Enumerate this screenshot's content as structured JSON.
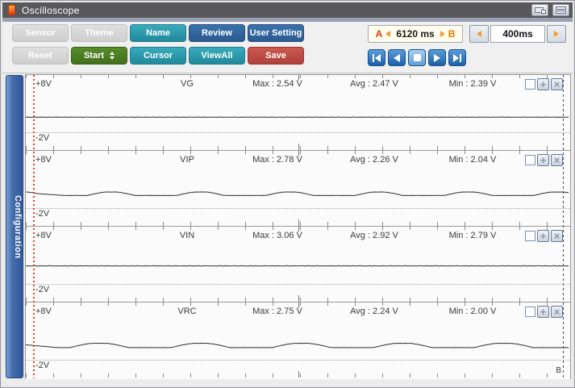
{
  "window": {
    "title": "Oscilloscope"
  },
  "toolbar": {
    "row1": [
      {
        "label": "Sensor"
      },
      {
        "label": "Theme"
      },
      {
        "label": "Name"
      },
      {
        "label": "Review"
      },
      {
        "label": "User Setting"
      }
    ],
    "row2": [
      {
        "label": "Reset"
      },
      {
        "label": "Start"
      },
      {
        "label": "Cursor"
      },
      {
        "label": "ViewAll"
      },
      {
        "label": "Save"
      }
    ],
    "ab_range": {
      "a_label": "A",
      "value": "6120 ms",
      "b_label": "B"
    },
    "timebase": {
      "value": "400ms"
    }
  },
  "sidebar": {
    "label": "Configuration"
  },
  "cursors": {
    "b_label": "B"
  },
  "channel_controls": {
    "plus_glyph": "+",
    "close_glyph": "×"
  },
  "channels": [
    {
      "name": "VG",
      "top_label": "+8V",
      "bottom_label": "-2V",
      "max": "Max : 2.54 V",
      "avg": "Avg : 2.47 V",
      "min": "Min : 2.39 V",
      "wave": {
        "kind": "flat",
        "level": 2.47,
        "noise": 0.04
      }
    },
    {
      "name": "VIP",
      "top_label": "+8V",
      "bottom_label": "-2V",
      "max": "Max : 2.78 V",
      "avg": "Avg : 2.26 V",
      "min": "Min : 2.04 V",
      "wave": {
        "kind": "bumps",
        "base": 2.08,
        "peak": 2.62,
        "period": 113,
        "bump_width": 60,
        "phase": 78,
        "lead_level": 2.5,
        "lead_end": 48
      }
    },
    {
      "name": "VIN",
      "top_label": "+8V",
      "bottom_label": "-2V",
      "max": "Max : 3.06 V",
      "avg": "Avg : 2.92 V",
      "min": "Min : 2.79 V",
      "wave": {
        "kind": "flat",
        "level": 2.92,
        "noise": 0.05
      }
    },
    {
      "name": "VRC",
      "top_label": "+8V",
      "bottom_label": "-2V",
      "max": "Max : 2.75 V",
      "avg": "Avg : 2.24 V",
      "min": "Min : 2.00 V",
      "wave": {
        "kind": "bumps",
        "base": 2.01,
        "peak": 2.68,
        "period": 128,
        "bump_width": 74,
        "phase": 56,
        "lead_level": 2.45,
        "lead_end": 40
      }
    }
  ],
  "colors": {
    "accent_teal": "#2b9fb0",
    "accent_blue": "#31659c",
    "accent_green": "#4d8022",
    "accent_red": "#bf4b44",
    "cursor_a": "#e2402b",
    "orange_marker": "#f59b35",
    "config_tab": "#2f579b",
    "titlebar": "#58575a"
  }
}
